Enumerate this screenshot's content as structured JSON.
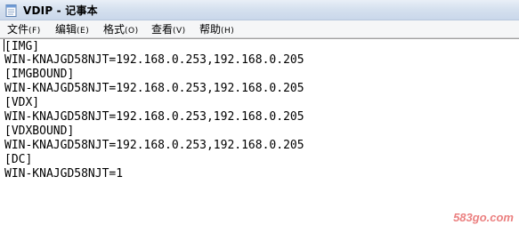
{
  "window": {
    "title": "VDIP - 记事本"
  },
  "menu": [
    {
      "label": "文件",
      "hotkey": "(F)"
    },
    {
      "label": "编辑",
      "hotkey": "(E)"
    },
    {
      "label": "格式",
      "hotkey": "(O)"
    },
    {
      "label": "查看",
      "hotkey": "(V)"
    },
    {
      "label": "帮助",
      "hotkey": "(H)"
    }
  ],
  "document": {
    "lines": [
      "[IMG]",
      "WIN-KNAJGD58NJT=192.168.0.253,192.168.0.205",
      "[IMGBOUND]",
      "WIN-KNAJGD58NJT=192.168.0.253,192.168.0.205",
      "[VDX]",
      "WIN-KNAJGD58NJT=192.168.0.253,192.168.0.205",
      "[VDXBOUND]",
      "WIN-KNAJGD58NJT=192.168.0.253,192.168.0.205",
      "[DC]",
      "WIN-KNAJGD58NJT=1"
    ]
  },
  "watermark": "583go.com",
  "colors": {
    "titlebar": "#d6e1ef",
    "menubar": "#f5f6f7",
    "text": "#000000",
    "watermark": "#e86a6a"
  },
  "icons": {
    "app": "notepad-icon"
  }
}
